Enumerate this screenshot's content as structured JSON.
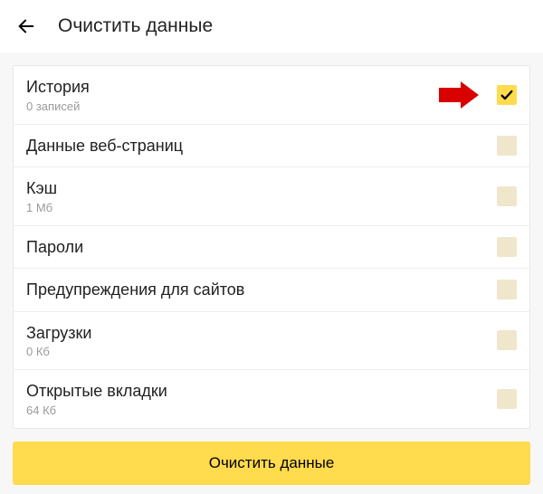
{
  "header": {
    "title": "Очистить данные"
  },
  "rows": [
    {
      "title": "История",
      "sub": "0 записей",
      "checked": true
    },
    {
      "title": "Данные веб-страниц",
      "sub": "",
      "checked": false
    },
    {
      "title": "Кэш",
      "sub": "1 Мб",
      "checked": false
    },
    {
      "title": "Пароли",
      "sub": "",
      "checked": false
    },
    {
      "title": "Предупреждения для сайтов",
      "sub": "",
      "checked": false
    },
    {
      "title": "Загрузки",
      "sub": "0 Кб",
      "checked": false
    },
    {
      "title": "Открытые вкладки",
      "sub": "64 Кб",
      "checked": false
    }
  ],
  "button": {
    "label": "Очистить данные"
  }
}
